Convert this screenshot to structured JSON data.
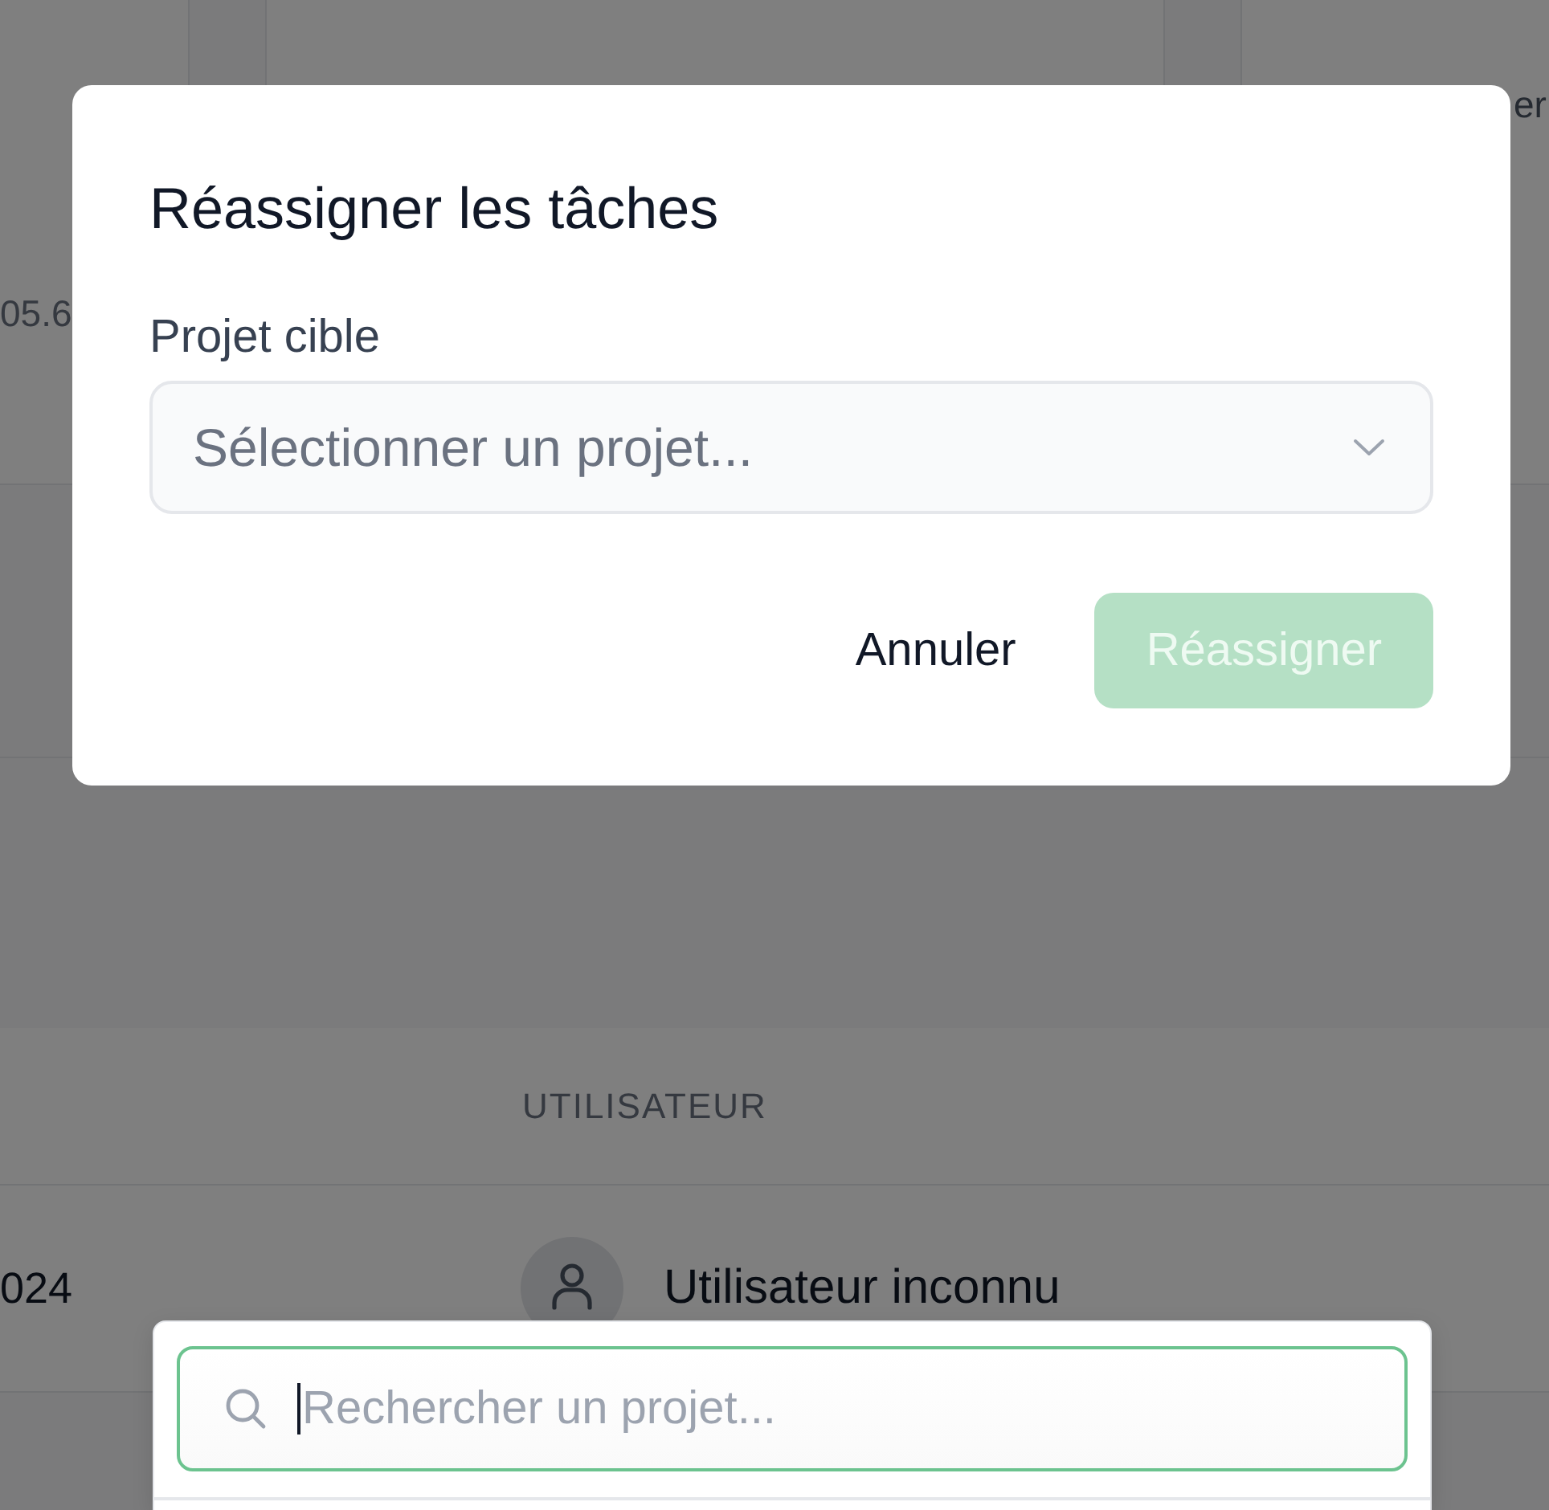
{
  "background_page": {
    "stat_value": "05.6",
    "card_text": "er",
    "table": {
      "columns": [
        {
          "label": "UTILISATEUR"
        }
      ],
      "rows": [
        {
          "column_1": "024",
          "user": "Utilisateur inconnu"
        }
      ]
    }
  },
  "dialog": {
    "title": "Réassigner les tâches",
    "field_label": "Projet cible",
    "select": {
      "placeholder": "Sélectionner un projet..."
    },
    "buttons": [
      {
        "label": "Annuler",
        "kind": "secondary",
        "disabled": false
      },
      {
        "label": "Réassigner",
        "kind": "primary",
        "disabled": true
      }
    ]
  },
  "dropdown": {
    "search": {
      "placeholder": "Rechercher un projet...",
      "focused": true
    }
  }
}
